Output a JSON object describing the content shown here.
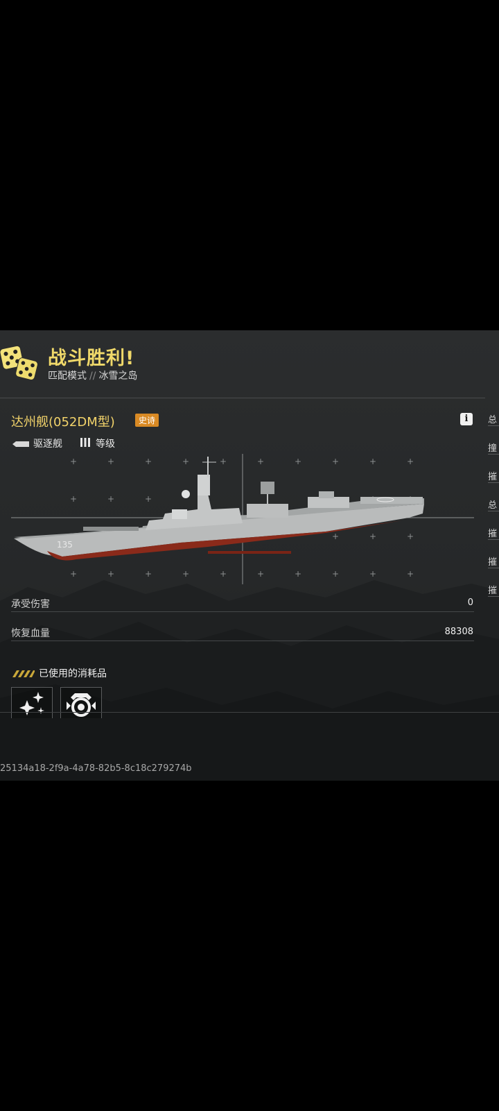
{
  "header": {
    "title": "战斗胜利!",
    "mode": "匹配模式",
    "separator": "//",
    "map": "冰雪之岛"
  },
  "ship": {
    "name": "达州舰(052DM型)",
    "rarity": "史诗",
    "class": "驱逐舰",
    "tier_label": "等级",
    "hull_number": "135"
  },
  "side_tabs": [
    "总",
    "撞",
    "摧",
    "总",
    "摧",
    "摧",
    "摧"
  ],
  "stats": [
    {
      "label": "承受伤害",
      "value": "0"
    },
    {
      "label": "恢复血量",
      "value": "88308"
    }
  ],
  "consumables": {
    "title": "已使用的消耗品",
    "items": [
      {
        "icon": "sparkle-icon"
      },
      {
        "icon": "repair-camera-icon"
      }
    ]
  },
  "session_id": "25134a18-2f9a-4a78-82b5-8c18c279274b",
  "colors": {
    "accent_yellow": "#f0d96a",
    "rarity_orange": "#d98a24",
    "panel_bg": "#2a2c2d",
    "hull_red": "#8a2a1a"
  }
}
